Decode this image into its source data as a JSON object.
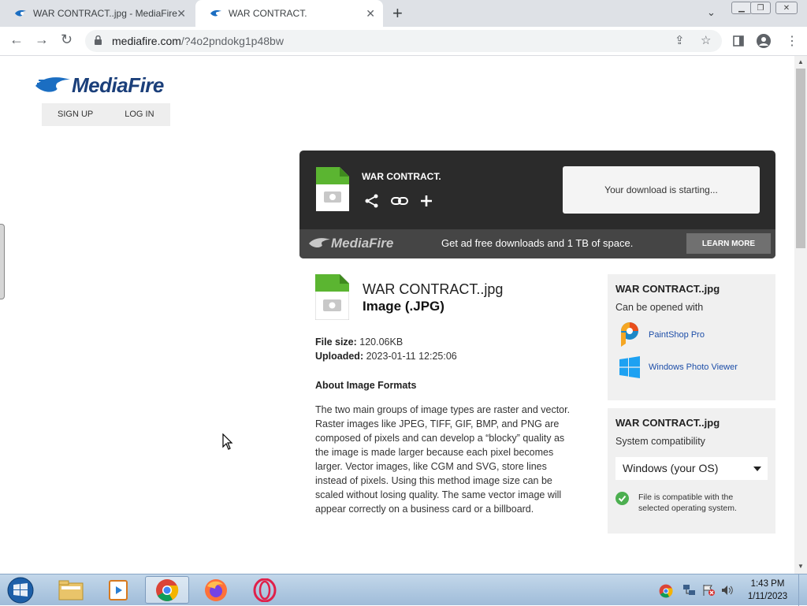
{
  "browser": {
    "tabs": [
      {
        "title": "WAR CONTRACT..jpg - MediaFire"
      },
      {
        "title": "WAR CONTRACT."
      }
    ],
    "url_host": "mediafire.com",
    "url_path": "/?4o2pndokg1p48bw"
  },
  "header": {
    "logo_text": "MediaFire",
    "sign_up": "SIGN UP",
    "log_in": "LOG IN"
  },
  "download": {
    "file_name": "WAR CONTRACT.",
    "status": "Your download is starting...",
    "promo_logo": "MediaFire",
    "promo_text": "Get ad free downloads and 1 TB of space.",
    "learn_more": "LEARN MORE"
  },
  "file": {
    "name": "WAR CONTRACT..jpg",
    "type": "Image (.JPG)",
    "size_label": "File size:",
    "size": "120.06KB",
    "uploaded_label": "Uploaded:",
    "uploaded": "2023-01-11 12:25:06",
    "about_title": "About Image Formats",
    "about_body": "The two main groups of image types are raster and vector. Raster images like JPEG, TIFF, GIF, BMP, and PNG are composed of pixels and can develop a “blocky” quality as the image is made larger because each pixel becomes larger. Vector images, like CGM and SVG, store lines instead of pixels. Using this method image size can be scaled without losing quality. The same vector image will appear correctly on a business card or a billboard."
  },
  "sidebar": {
    "open_with": {
      "title": "WAR CONTRACT..jpg",
      "subtitle": "Can be opened with",
      "apps": [
        "PaintShop Pro",
        "Windows Photo Viewer"
      ]
    },
    "compat": {
      "title": "WAR CONTRACT..jpg",
      "subtitle": "System compatibility",
      "selected_os": "Windows (your OS)",
      "message": "File is compatible with the selected operating system."
    }
  },
  "taskbar": {
    "time": "1:43 PM",
    "date": "1/11/2023"
  },
  "colors": {
    "accent_blue": "#1b6ec2",
    "dark_panel": "#2b2b2b",
    "file_green": "#5bb531",
    "taskbar": "#b3cbe3"
  }
}
